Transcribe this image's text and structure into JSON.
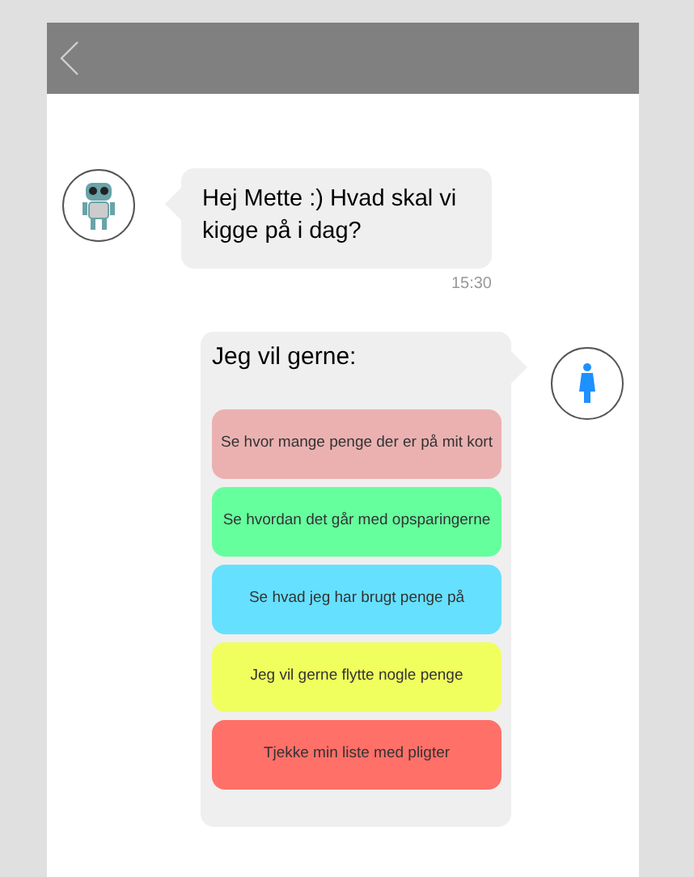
{
  "bot_message": {
    "text": "Hej Mette :) Hvad skal vi kigge på i dag?",
    "time": "15:30"
  },
  "user_message": {
    "text": "Jeg vil gerne:",
    "options": [
      {
        "label": "Se hvor mange penge der er på mit kort",
        "color": "#ebb1b1"
      },
      {
        "label": "Se hvordan det går med opsparingerne",
        "color": "#66ff9d"
      },
      {
        "label": "Se hvad jeg har brugt penge på",
        "color": "#66e0ff"
      },
      {
        "label": "Jeg vil gerne flytte nogle penge",
        "color": "#f0ff5e"
      },
      {
        "label": "Tjekke min liste med pligter",
        "color": "#ff7068"
      }
    ]
  }
}
